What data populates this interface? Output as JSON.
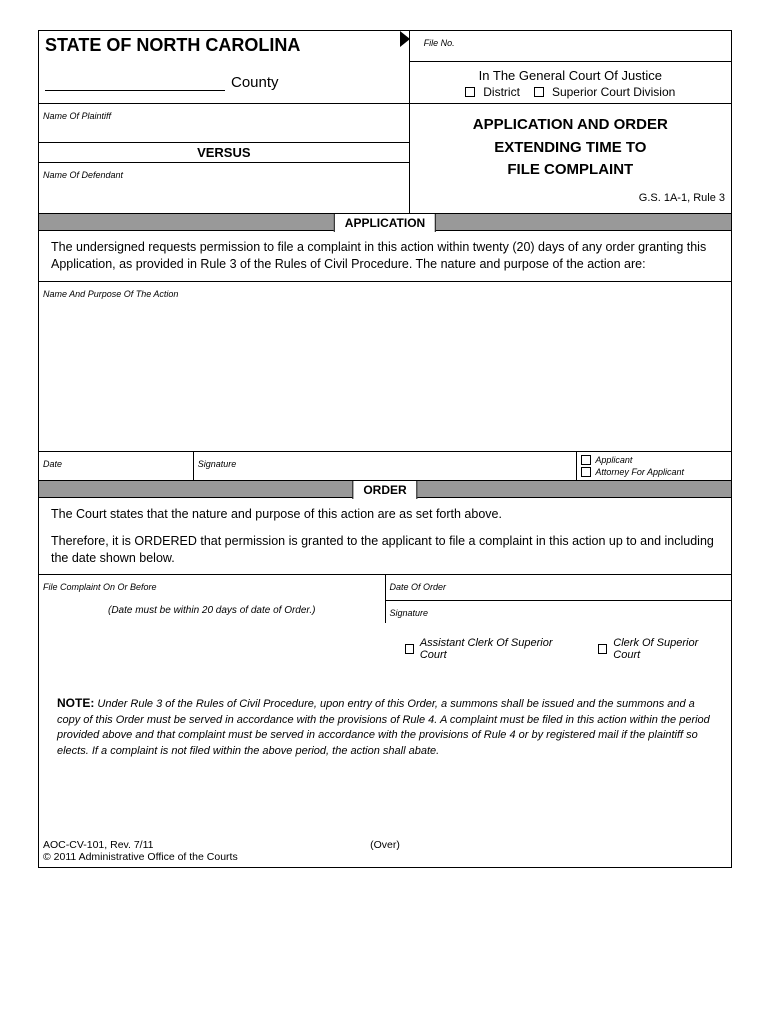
{
  "header": {
    "state_title": "STATE OF NORTH CAROLINA",
    "county_label": "County",
    "file_no_label": "File No.",
    "court_line": "In The General Court Of Justice",
    "district_label": "District",
    "superior_label": "Superior Court Division"
  },
  "parties": {
    "plaintiff_label": "Name Of Plaintiff",
    "versus": "VERSUS",
    "defendant_label": "Name Of Defendant"
  },
  "title": {
    "line1": "APPLICATION AND ORDER",
    "line2": "EXTENDING TIME TO",
    "line3": "FILE COMPLAINT",
    "gs": "G.S. 1A-1, Rule 3"
  },
  "sections": {
    "application": "APPLICATION",
    "order": "ORDER"
  },
  "application": {
    "body": "The undersigned requests permission to file a complaint in this action within twenty (20) days of any order granting this Application, as provided in Rule 3 of the Rules of Civil Procedure. The nature and purpose of the action are:",
    "name_purpose_label": "Name And Purpose Of The Action",
    "date_label": "Date",
    "signature_label": "Signature",
    "applicant_label": "Applicant",
    "attorney_label": "Attorney For Applicant"
  },
  "order": {
    "body1": "The Court states that the nature and purpose of this action are as set forth above.",
    "body2": "Therefore, it is ORDERED that permission is granted to the applicant to file a complaint in this action up to and including the date shown below.",
    "file_before_label": "File Complaint On Or Before",
    "date_hint": "(Date must be within 20 days of date of Order.)",
    "date_order_label": "Date Of Order",
    "signature_label": "Signature",
    "asst_clerk_label": "Assistant Clerk Of Superior Court",
    "clerk_label": "Clerk Of Superior Court"
  },
  "note": {
    "label": "NOTE:",
    "text": "Under Rule 3 of the Rules of Civil Procedure, upon entry of this Order, a summons shall be issued and the summons and a copy of this Order must be served in accordance with the provisions of Rule 4. A complaint must be filed in this action within the period provided above and that complaint must be served in accordance with the provisions of Rule 4 or by registered mail if the plaintiff so elects. If a complaint is not filed within the above period, the action shall abate."
  },
  "footer": {
    "form_id": "AOC-CV-101, Rev. 7/11",
    "copyright": "© 2011 Administrative Office of the Courts",
    "over": "(Over)"
  }
}
